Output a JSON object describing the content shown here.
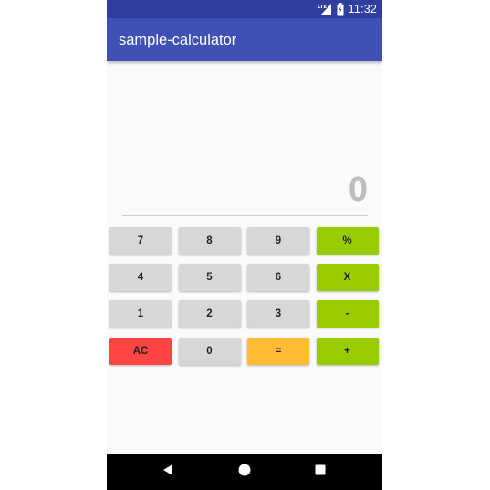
{
  "status_bar": {
    "network_label": "LTE",
    "time": "11:32",
    "icons": [
      "lte-signal-icon",
      "battery-icon"
    ]
  },
  "app_bar": {
    "title": "sample-calculator"
  },
  "display": {
    "value": "0"
  },
  "keypad": {
    "rows": [
      [
        "7",
        "8",
        "9",
        "%"
      ],
      [
        "4",
        "5",
        "6",
        "X"
      ],
      [
        "1",
        "2",
        "3",
        "-"
      ],
      [
        "AC",
        "0",
        "=",
        "+"
      ]
    ]
  },
  "nav_bar": {
    "icons": [
      "back-icon",
      "home-icon",
      "recents-icon"
    ]
  },
  "colors": {
    "status_bar": "#303f9f",
    "app_bar": "#3f51b5",
    "number_key": "#d6d7d7",
    "operator_key": "#99cc00",
    "clear_key": "#ff4444",
    "equals_key": "#ffbb33",
    "display_text": "#bdbdbd"
  }
}
